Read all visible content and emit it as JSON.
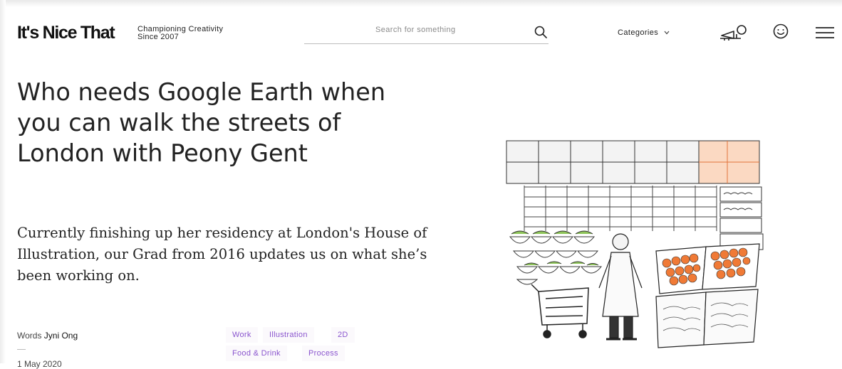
{
  "header": {
    "logo": "It's Nice That",
    "tagline_line1": "Championing Creativity",
    "tagline_line2": "Since 2007",
    "search_placeholder": "Search for something",
    "categories_label": "Categories",
    "icons": [
      "search-icon",
      "chevron-down-icon",
      "megaphone-icon",
      "smiley-icon",
      "menu-icon"
    ]
  },
  "article": {
    "title": "Who needs Google Earth when you can walk the streets of London with Peony Gent",
    "standfirst": "Currently finishing up her residency at London's House of Illustration, our Grad from 2016 updates us on what she’s been working on.",
    "byline_prefix": "Words",
    "author": "Jyni Ong",
    "date": "1 May 2020",
    "tags": [
      "Work",
      "Illustration",
      "2D",
      "Food & Drink",
      "Process"
    ]
  },
  "colors": {
    "tag_text": "#8a55ce",
    "tag_bg": "#fbf9fc",
    "orange": "#f07a36",
    "leaf_green": "#8fc55a"
  }
}
